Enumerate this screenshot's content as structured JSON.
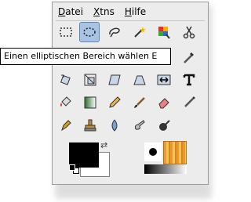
{
  "menu": {
    "file": {
      "first": "D",
      "rest": "atei"
    },
    "extensions": {
      "first": "X",
      "rest": "tns"
    },
    "help": {
      "first": "H",
      "rest": "ilfe"
    }
  },
  "tooltip": {
    "text": "Einen elliptischen Bereich wählen    E"
  },
  "tools": [
    "rectangle-select-icon",
    "ellipse-select-icon",
    "free-select-icon",
    "fuzzy-select-icon",
    "select-by-color-icon",
    "scissors-select-icon",
    "paths-icon",
    "color-picker-icon",
    "rotate-icon",
    "scale-icon",
    "shear-icon",
    "perspective-icon",
    "flip-icon",
    "text-icon",
    "bucket-fill-icon",
    "blend-icon",
    "pencil-icon",
    "paintbrush-icon",
    "eraser-icon",
    "airbrush-icon",
    "ink-icon",
    "clone-icon",
    "blur-icon",
    "smudge-icon",
    "dodge-burn-icon"
  ],
  "colors": {
    "foreground": "#000000",
    "background": "#ffffff",
    "selection_highlight": "#a9c3e4"
  }
}
